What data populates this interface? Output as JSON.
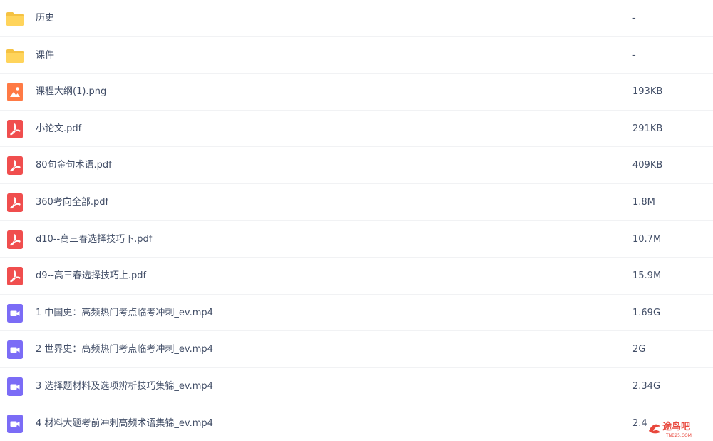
{
  "files": [
    {
      "name": "历史",
      "size": "-",
      "type": "folder",
      "icon": "folder-icon"
    },
    {
      "name": "课件",
      "size": "-",
      "type": "folder",
      "icon": "folder-icon"
    },
    {
      "name": "课程大纲(1).png",
      "size": "193KB",
      "type": "image",
      "icon": "image-file-icon"
    },
    {
      "name": "小论文.pdf",
      "size": "291KB",
      "type": "pdf",
      "icon": "pdf-file-icon"
    },
    {
      "name": "80句金句术语.pdf",
      "size": "409KB",
      "type": "pdf",
      "icon": "pdf-file-icon"
    },
    {
      "name": "360考向全部.pdf",
      "size": "1.8M",
      "type": "pdf",
      "icon": "pdf-file-icon"
    },
    {
      "name": "d10--高三春选择技巧下.pdf",
      "size": "10.7M",
      "type": "pdf",
      "icon": "pdf-file-icon"
    },
    {
      "name": "d9--高三春选择技巧上.pdf",
      "size": "15.9M",
      "type": "pdf",
      "icon": "pdf-file-icon"
    },
    {
      "name": "1 中国史：高频热门考点临考冲刺_ev.mp4",
      "size": "1.69G",
      "type": "video",
      "icon": "video-file-icon"
    },
    {
      "name": "2 世界史：高频热门考点临考冲刺_ev.mp4",
      "size": "2G",
      "type": "video",
      "icon": "video-file-icon"
    },
    {
      "name": "3 选择题材料及选项辨析技巧集锦_ev.mp4",
      "size": "2.34G",
      "type": "video",
      "icon": "video-file-icon"
    },
    {
      "name": "4 材料大题考前冲刺高频术语集锦_ev.mp4",
      "size": "2.4",
      "type": "video",
      "icon": "video-file-icon"
    }
  ],
  "watermark": {
    "text": "途鸟吧",
    "subtext": "TNB25.COM",
    "icon": "bird-logo-icon"
  },
  "colors": {
    "folder": "#ffd45b",
    "image": "#ff7a45",
    "pdf": "#f04e4e",
    "video": "#7b6cf6",
    "text": "#424e67",
    "divider": "#f1f2f4",
    "watermark": "#e8473c"
  }
}
